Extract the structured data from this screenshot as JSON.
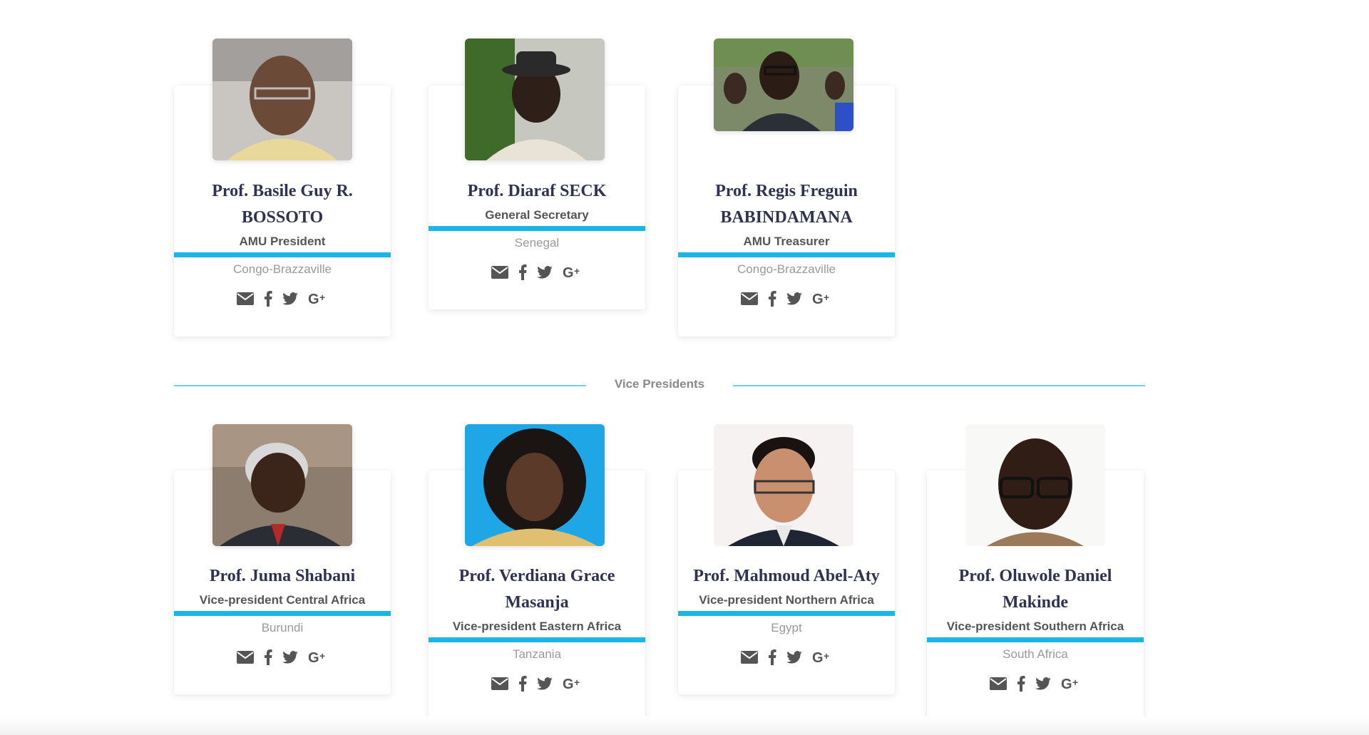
{
  "executive": [
    {
      "name": "Prof. Basile Guy R. BOSSOTO",
      "role": "AMU President",
      "country": "Congo-Brazzaville",
      "photo_icon": "portrait-photo"
    },
    {
      "name": "Prof. Diaraf SECK",
      "role": "General Secretary",
      "country": "Senegal",
      "photo_icon": "portrait-photo"
    },
    {
      "name": "Prof. Regis Freguin BABINDAMANA",
      "role": "AMU Treasurer",
      "country": "Congo-Brazzaville",
      "photo_icon": "portrait-photo"
    }
  ],
  "vice_presidents_heading": "Vice Presidents",
  "vice_presidents": [
    {
      "name": "Prof. Juma Shabani",
      "role": "Vice-president Central Africa",
      "country": "Burundi",
      "photo_icon": "portrait-photo"
    },
    {
      "name": "Prof. Verdiana Grace Masanja",
      "role": "Vice-president Eastern Africa",
      "country": "Tanzania",
      "photo_icon": "portrait-photo"
    },
    {
      "name": "Prof. Mahmoud Abel-Aty",
      "role": "Vice-president Northern Africa",
      "country": "Egypt",
      "photo_icon": "portrait-photo"
    },
    {
      "name": "Prof. Oluwole Daniel Makinde",
      "role": "Vice-president Southern Africa",
      "country": "South Africa",
      "photo_icon": "portrait-photo"
    }
  ],
  "social_icons": [
    "envelope-icon",
    "facebook-icon",
    "twitter-icon",
    "google-plus-icon"
  ],
  "colors": {
    "accent": "#1ab6e8",
    "name_text": "#2d3350",
    "role_text": "#555555",
    "country_text": "#999999",
    "icon": "#555555",
    "divider": "#6fd0ee"
  }
}
